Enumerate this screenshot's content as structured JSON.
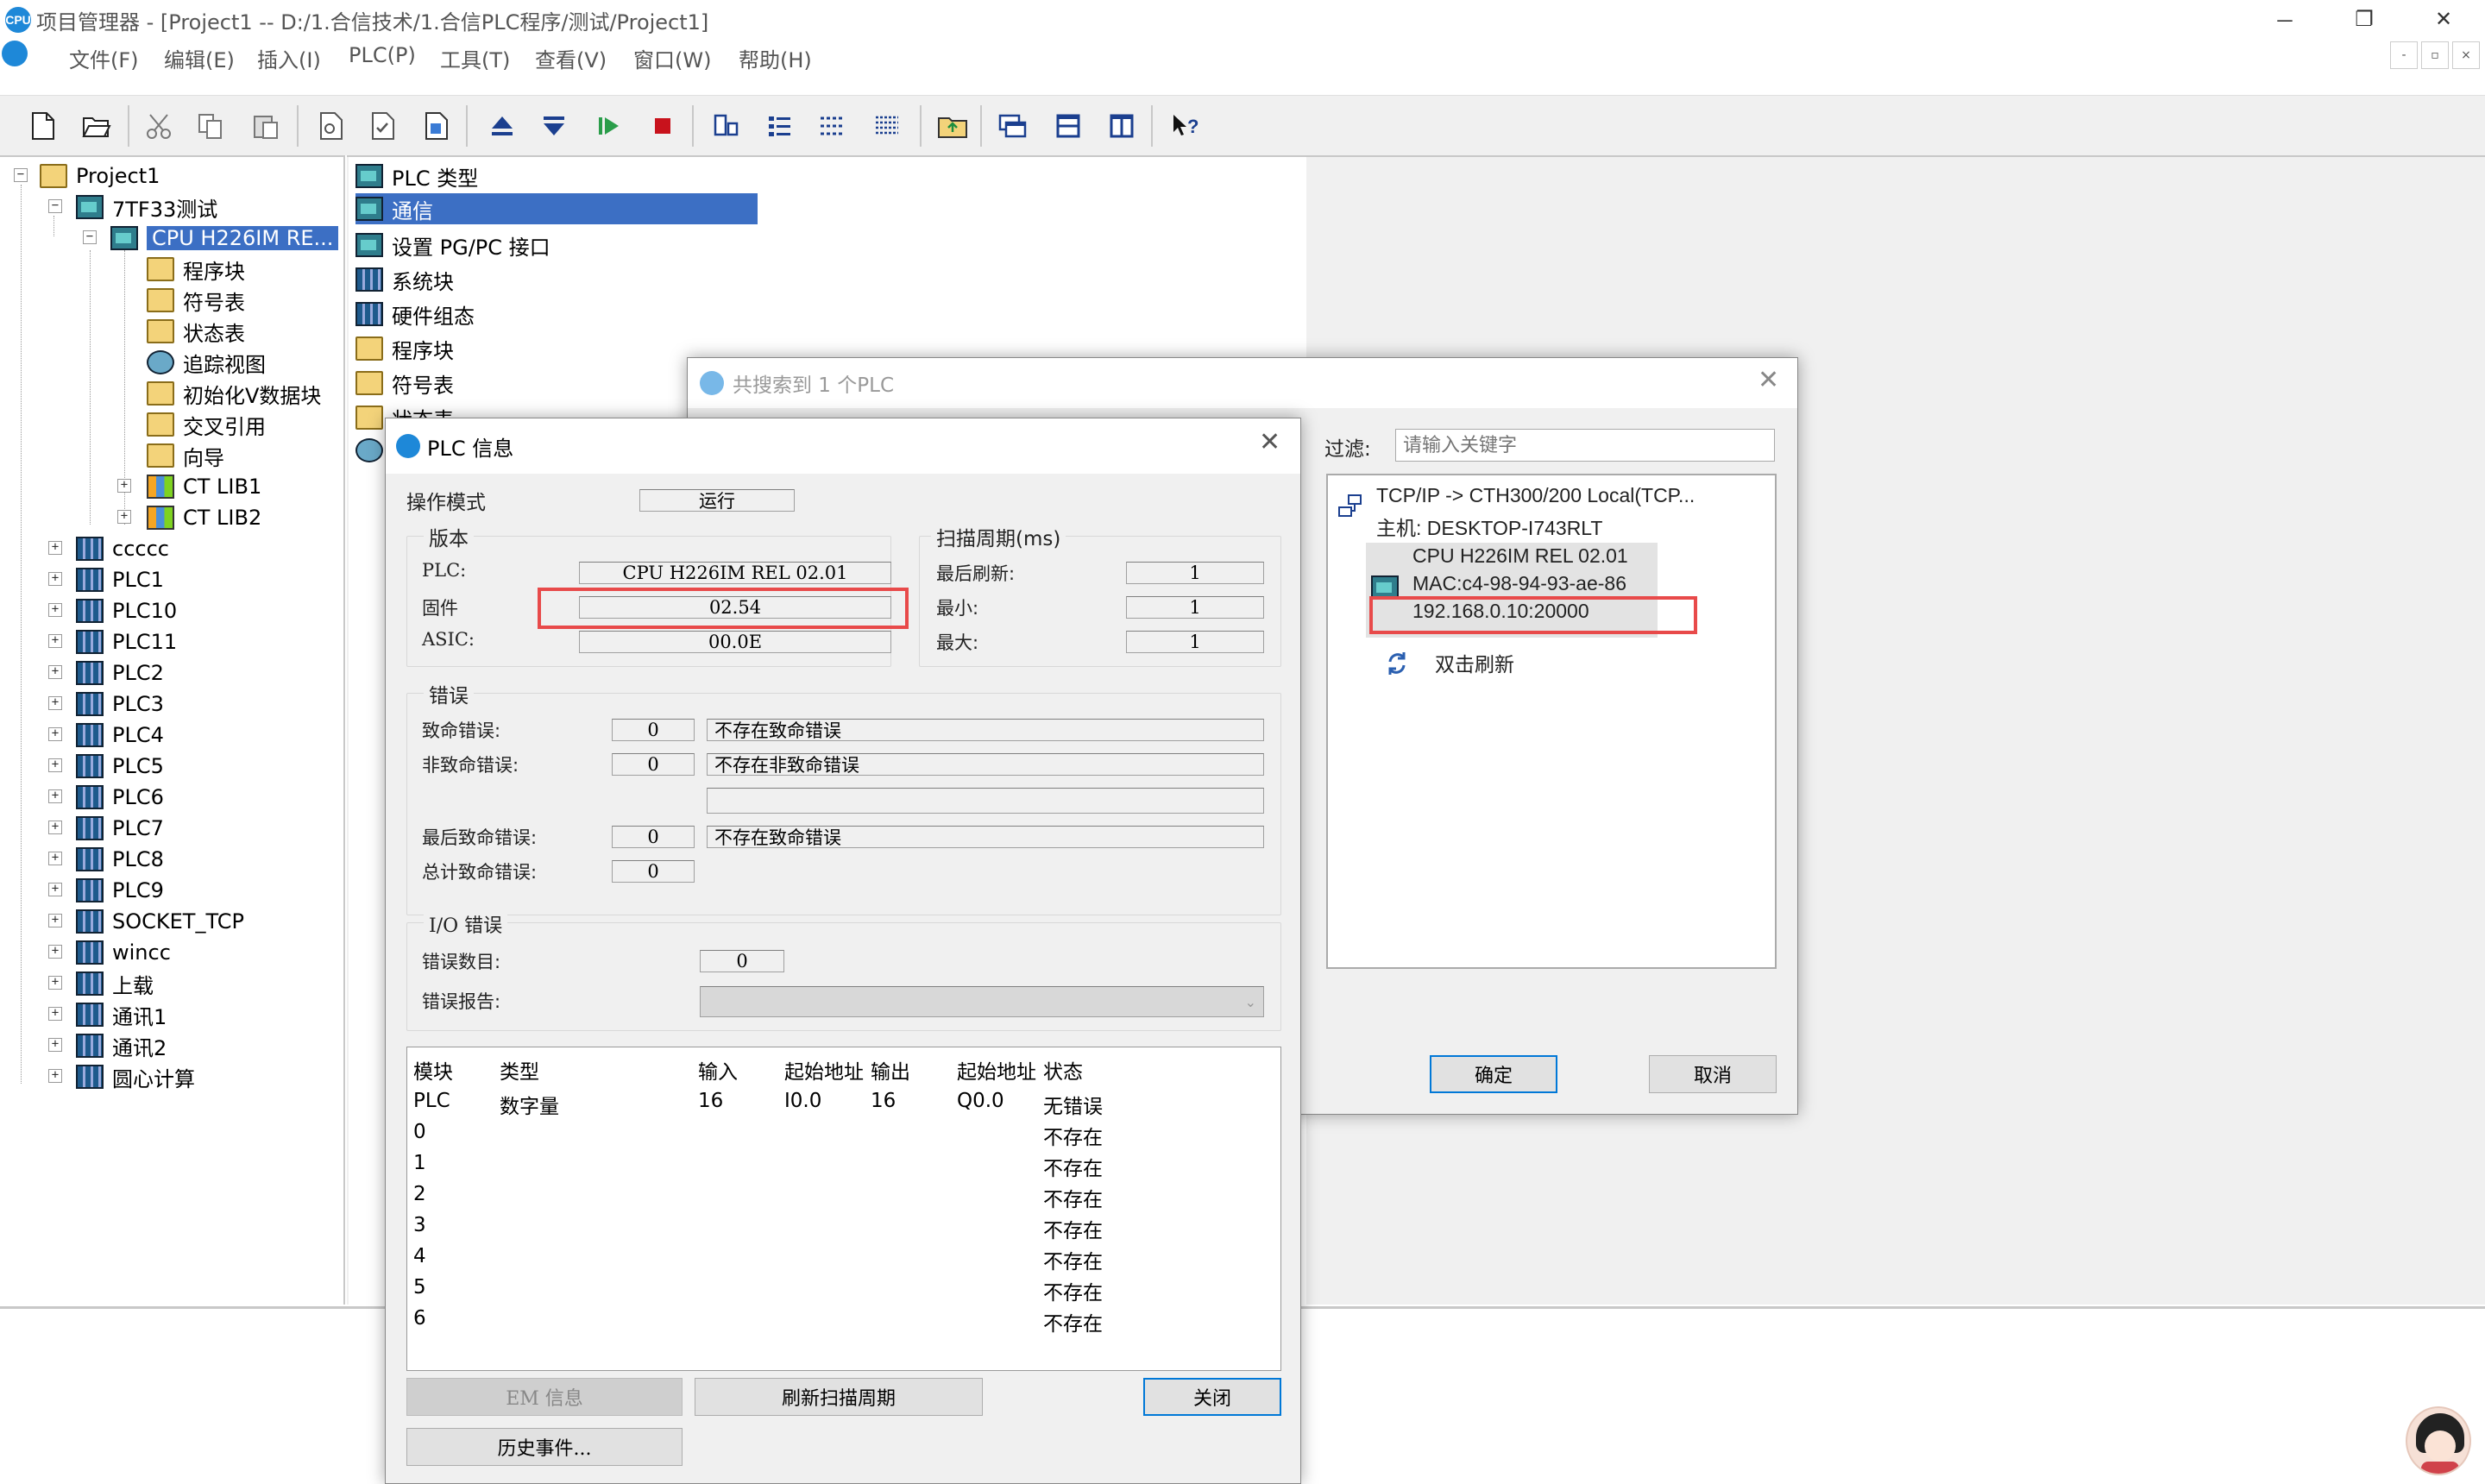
{
  "window": {
    "title": "项目管理器 - [Project1 -- D:/1.合信技术/1.合信PLC程序/测试/Project1]",
    "app_badge": "CPU",
    "minimize": "－",
    "restore": "❐",
    "close": "✕"
  },
  "menu": [
    "文件(F)",
    "编辑(E)",
    "插入(I)",
    "PLC(P)",
    "工具(T)",
    "查看(V)",
    "窗口(W)",
    "帮助(H)"
  ],
  "mdi_buttons": [
    "-",
    "▫",
    "×"
  ],
  "tree": {
    "root": "Project1",
    "project": "7TF33测试",
    "cpu": "CPU H226IM RE...",
    "cpu_children": [
      "程序块",
      "符号表",
      "状态表",
      "追踪视图",
      "初始化V数据块",
      "交叉引用",
      "向导",
      "CT LIB1",
      "CT LIB2"
    ],
    "plcs": [
      "ccccc",
      "PLC1",
      "PLC10",
      "PLC11",
      "PLC2",
      "PLC3",
      "PLC4",
      "PLC5",
      "PLC6",
      "PLC7",
      "PLC8",
      "PLC9",
      "SOCKET_TCP",
      "wincc",
      "上载",
      "通讯1",
      "通讯2",
      "圆心计算"
    ]
  },
  "right_list": [
    "PLC 类型",
    "通信",
    "设置 PG/PC 接口",
    "系统块",
    "硬件组态",
    "程序块",
    "符号表",
    "状态表"
  ],
  "search_dialog": {
    "title": "共搜索到 1 个PLC",
    "filter_label": "过滤:",
    "filter_placeholder": "请输入关键字",
    "conn_line1": "TCP/IP -> CTH300/200 Local(TCP...",
    "conn_line2": "主机:  DESKTOP-I743RLT",
    "device_name": "CPU H226IM REL 02.01",
    "device_mac": "MAC:c4-98-94-93-ae-86",
    "device_ip": "192.168.0.10:20000",
    "refresh": "双击刷新",
    "ok": "确定",
    "cancel": "取消"
  },
  "plc_info": {
    "title": "PLC 信息",
    "op_mode_label": "操作模式",
    "op_mode_value": "运行",
    "version_group": "版本",
    "plc_label": "PLC:",
    "plc_value": "CPU H226IM REL 02.01",
    "firmware_label": "固件",
    "firmware_value": "02.54",
    "asic_label": "ASIC:",
    "asic_value": "00.0E",
    "scan_group": "扫描周期(ms)",
    "last_refresh_label": "最后刷新:",
    "last_refresh_value": "1",
    "min_label": "最小:",
    "min_value": "1",
    "max_label": "最大:",
    "max_value": "1",
    "error_group": "错误",
    "fatal_label": "致命错误:",
    "fatal_code": "0",
    "fatal_text": "不存在致命错误",
    "nonfatal_label": "非致命错误:",
    "nonfatal_code": "0",
    "nonfatal_text": "不存在非致命错误",
    "last_fatal_label": "最后致命错误:",
    "last_fatal_code": "0",
    "last_fatal_text": "不存在致命错误",
    "total_fatal_label": "总计致命错误:",
    "total_fatal_code": "0",
    "io_group": "I/O 错误",
    "err_count_label": "错误数目:",
    "err_count_value": "0",
    "err_report_label": "错误报告:",
    "table_headers": [
      "模块",
      "类型",
      "输入",
      "起始地址",
      "输出",
      "起始地址",
      "状态"
    ],
    "table_rows": [
      [
        "PLC",
        "数字量",
        "16",
        "I0.0",
        "16",
        "Q0.0",
        "无错误"
      ],
      [
        "0",
        "",
        "",
        "",
        "",
        "",
        "不存在"
      ],
      [
        "1",
        "",
        "",
        "",
        "",
        "",
        "不存在"
      ],
      [
        "2",
        "",
        "",
        "",
        "",
        "",
        "不存在"
      ],
      [
        "3",
        "",
        "",
        "",
        "",
        "",
        "不存在"
      ],
      [
        "4",
        "",
        "",
        "",
        "",
        "",
        "不存在"
      ],
      [
        "5",
        "",
        "",
        "",
        "",
        "",
        "不存在"
      ],
      [
        "6",
        "",
        "",
        "",
        "",
        "",
        "不存在"
      ]
    ],
    "em_info": "EM 信息",
    "refresh_scan": "刷新扫描周期",
    "close": "关闭",
    "history": "历史事件..."
  },
  "colors": {
    "selection": "#3c6fc4",
    "highlight_box": "#e84a4a",
    "dialog_bg": "#f0f0f0",
    "primary_border": "#0078d7"
  }
}
